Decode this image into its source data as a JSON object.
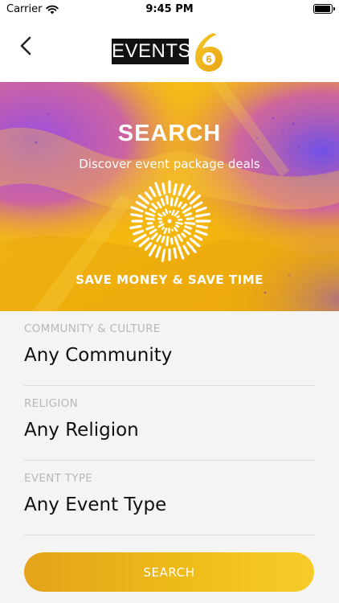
{
  "status_bar": {
    "carrier": "Carrier",
    "time": "9:45 PM"
  },
  "header": {
    "logo_text": "EVENTS",
    "logo_number": "6",
    "back_icon": "chevron-left-icon"
  },
  "hero": {
    "title": "SEARCH",
    "subtitle": "Discover event package deals",
    "tagline": "SAVE MONEY & SAVE TIME",
    "icon": "starburst-icon"
  },
  "filters": [
    {
      "label": "COMMUNITY & CULTURE",
      "value": "Any Community"
    },
    {
      "label": "RELIGION",
      "value": "Any Religion"
    },
    {
      "label": "EVENT TYPE",
      "value": "Any Event Type"
    }
  ],
  "search_button": {
    "label": "SEARCH"
  },
  "colors": {
    "accent": "#EFB919",
    "hero_purple": "#8A4DD6",
    "hero_pink": "#E94BA8",
    "label_gray": "#B8B8B8"
  }
}
